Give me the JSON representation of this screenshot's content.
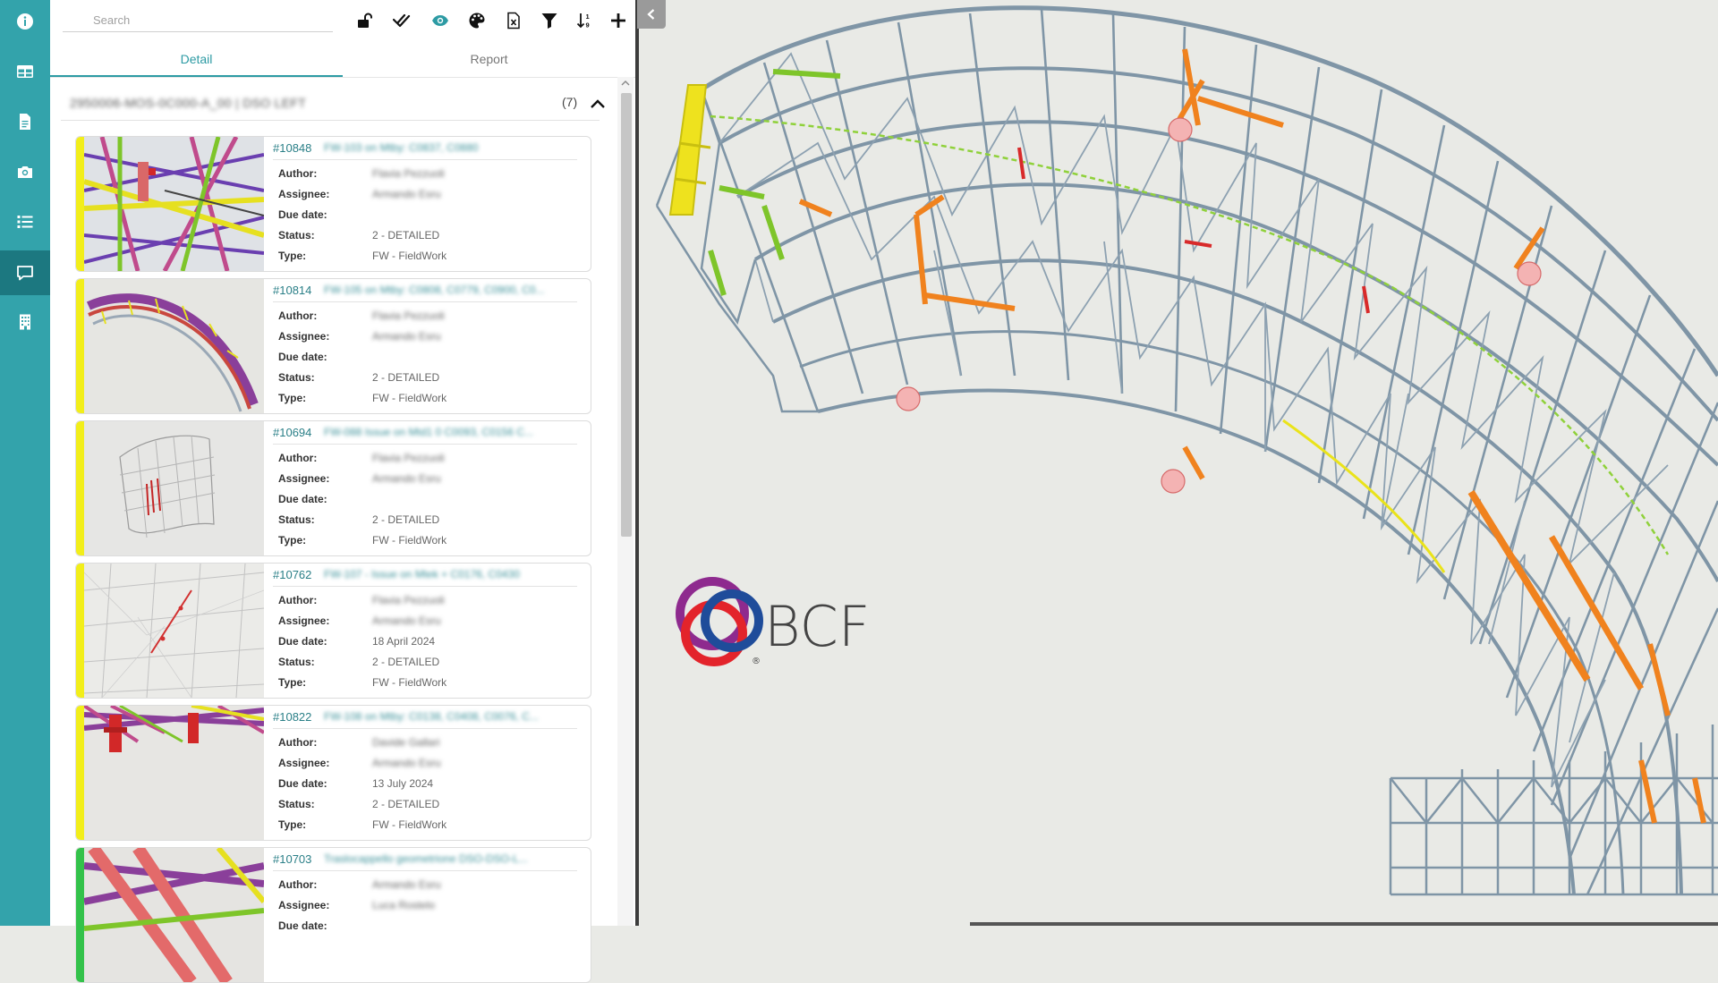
{
  "rail": {
    "items": [
      {
        "icon": "info-icon",
        "active": false
      },
      {
        "icon": "table-icon",
        "active": false
      },
      {
        "icon": "document-icon",
        "active": false
      },
      {
        "icon": "camera-icon",
        "active": false
      },
      {
        "icon": "list-icon",
        "active": false
      },
      {
        "icon": "comment-icon",
        "active": true
      },
      {
        "icon": "building-icon",
        "active": false
      }
    ]
  },
  "search": {
    "placeholder": "Search"
  },
  "toolbar": {
    "icons": [
      "unlock-icon",
      "double-check-icon",
      "eye-icon",
      "palette-icon",
      "excel-export-icon",
      "filter-icon",
      "sort-icon",
      "add-icon"
    ],
    "accent": "#2d9ba4"
  },
  "tabs": [
    {
      "label": "Detail",
      "active": true
    },
    {
      "label": "Report",
      "active": false
    }
  ],
  "group": {
    "title": "2950006-MOS-0C000-A_00 | DSO LEFT",
    "count": "(7)"
  },
  "labels": {
    "author": "Author:",
    "assignee": "Assignee:",
    "due": "Due date:",
    "status": "Status:",
    "type": "Type:"
  },
  "issues": [
    {
      "id": "#10848",
      "title": "FW-103 on Mtby: C0837, C0880",
      "author": "Flavia Pezzuoli",
      "assignee": "Armando Esru",
      "due": "",
      "status": "2 - DETAILED",
      "type": "FW - FieldWork",
      "stripe": "#f2ee1a"
    },
    {
      "id": "#10814",
      "title": "FW-105 on Mtby: C0808, C0779, C0900, C0...",
      "author": "Flavia Pezzuoli",
      "assignee": "Armando Esru",
      "due": "",
      "status": "2 - DETAILED",
      "type": "FW - FieldWork",
      "stripe": "#f2ee1a"
    },
    {
      "id": "#10694",
      "title": "FW-088 Issue on Mtd1 0 C0093, C0156 C...",
      "author": "Flavia Pezzuoli",
      "assignee": "Armando Esru",
      "due": "",
      "status": "2 - DETAILED",
      "type": "FW - FieldWork",
      "stripe": "#f2ee1a"
    },
    {
      "id": "#10762",
      "title": "FW-107 - Issue on Mtek + C0176, C0430",
      "author": "Flavia Pezzuoli",
      "assignee": "Armando Esru",
      "due": "18 April 2024",
      "status": "2 - DETAILED",
      "type": "FW - FieldWork",
      "stripe": "#f2ee1a"
    },
    {
      "id": "#10822",
      "title": "FW-108 on Mtby: C0138, C0408, C0076, C...",
      "author": "Davide Gallari",
      "assignee": "Armando Esru",
      "due": "13 July 2024",
      "status": "2 - DETAILED",
      "type": "FW - FieldWork",
      "stripe": "#f2ee1a"
    },
    {
      "id": "#10703",
      "title": "Traslocappello geometrione DSO-DSO-L...",
      "author": "Armando Esru",
      "assignee": "Luca Rostelo",
      "due": "",
      "status": "",
      "type": "",
      "stripe": "#33c24a"
    }
  ],
  "viewer": {
    "logo_text": "BCF",
    "logo_mark": "®",
    "background": "#e9eae6",
    "steel_color": "#7f95a6"
  }
}
